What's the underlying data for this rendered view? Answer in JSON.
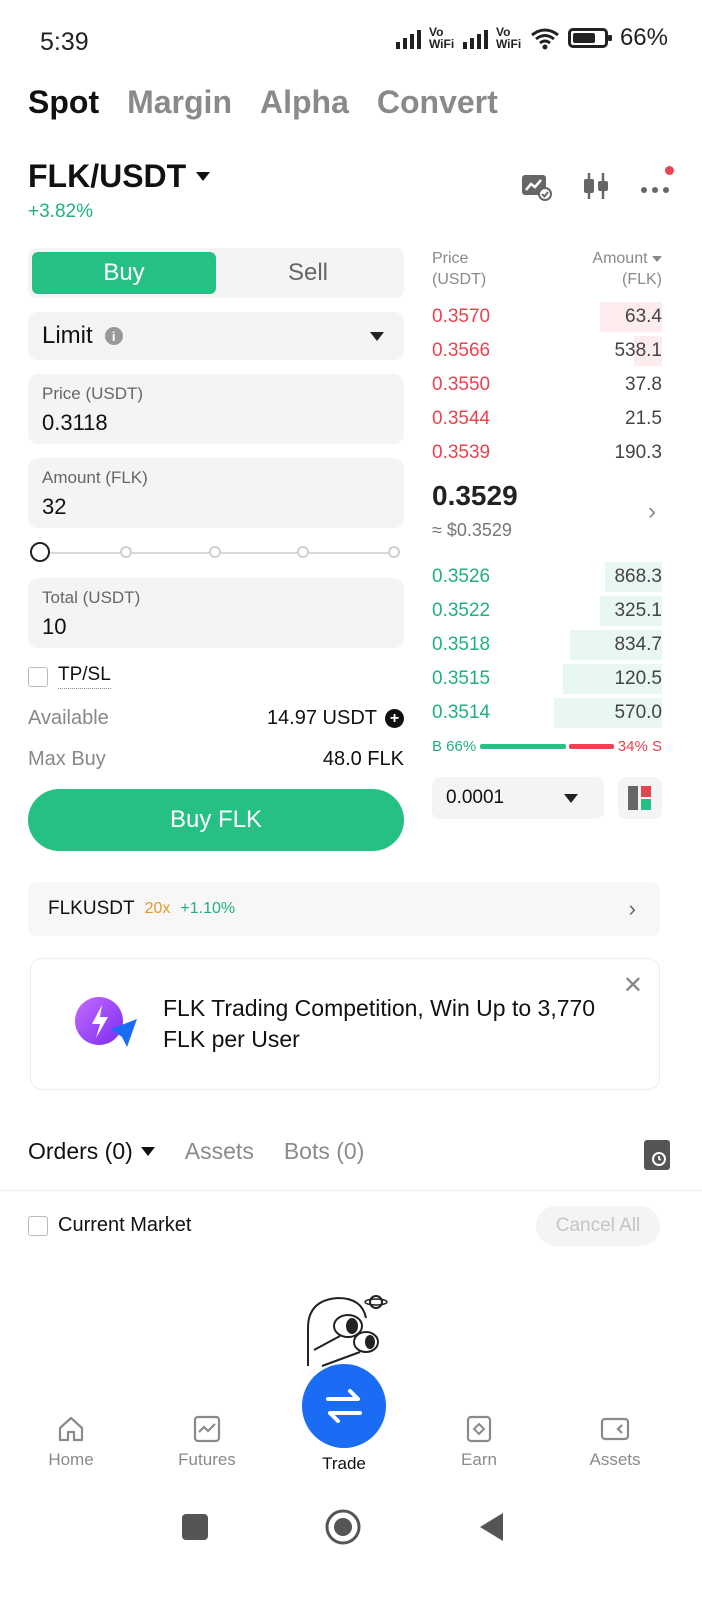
{
  "status_bar": {
    "time": "5:39",
    "net1": "Vo WiFi",
    "net2": "Vo WiFi",
    "battery": "66%"
  },
  "top_tabs": [
    {
      "label": "Spot",
      "active": true
    },
    {
      "label": "Margin",
      "active": false
    },
    {
      "label": "Alpha",
      "active": false
    },
    {
      "label": "Convert",
      "active": false
    }
  ],
  "pair": {
    "symbol": "FLK/USDT",
    "change": "+3.82%",
    "icons": [
      "chart-switch-icon",
      "candlestick-icon",
      "more-icon"
    ]
  },
  "order_form": {
    "buy_label": "Buy",
    "sell_label": "Sell",
    "order_type": "Limit",
    "price_label": "Price (USDT)",
    "price_value": "0.3118",
    "amount_label": "Amount (FLK)",
    "amount_value": "32",
    "total_label": "Total (USDT)",
    "total_value": "10",
    "tpsl_label": "TP/SL",
    "available_label": "Available",
    "available_value": "14.97 USDT",
    "max_buy_label": "Max Buy",
    "max_buy_value": "48.0 FLK",
    "submit_label": "Buy FLK",
    "slider_level": 0
  },
  "orderbook": {
    "price_header_1": "Price",
    "price_header_2": "(USDT)",
    "amount_header_1": "Amount",
    "amount_header_2": "(FLK)",
    "asks": [
      {
        "price": "0.3570",
        "amount": "63.4",
        "depth": 0.27
      },
      {
        "price": "0.3566",
        "amount": "538.1",
        "depth": 0.12
      },
      {
        "price": "0.3550",
        "amount": "37.8",
        "depth": 0.0
      },
      {
        "price": "0.3544",
        "amount": "21.5",
        "depth": 0.0
      },
      {
        "price": "0.3539",
        "amount": "190.3",
        "depth": 0.0
      }
    ],
    "mid_price": "0.3529",
    "mid_usd": "≈ $0.3529",
    "bids": [
      {
        "price": "0.3526",
        "amount": "868.3",
        "depth": 0.25
      },
      {
        "price": "0.3522",
        "amount": "325.1",
        "depth": 0.27
      },
      {
        "price": "0.3518",
        "amount": "834.7",
        "depth": 0.4
      },
      {
        "price": "0.3515",
        "amount": "120.5",
        "depth": 0.43
      },
      {
        "price": "0.3514",
        "amount": "570.0",
        "depth": 0.47
      }
    ],
    "buy_ratio_label": "B 66%",
    "sell_ratio_label": "34% S",
    "buy_ratio": 66,
    "sell_ratio": 34,
    "precision": "0.0001"
  },
  "futures_banner": {
    "symbol": "FLKUSDT",
    "leverage": "20x",
    "change": "+1.10%"
  },
  "promo": {
    "text": "FLK Trading Competition, Win Up to 3,770 FLK per User"
  },
  "orders": {
    "tabs": [
      "Orders (0)",
      "Assets",
      "Bots (0)"
    ],
    "current_market_label": "Current Market",
    "cancel_all_label": "Cancel All"
  },
  "bottom_nav": [
    {
      "label": "Home",
      "icon": "home-icon"
    },
    {
      "label": "Futures",
      "icon": "futures-icon"
    },
    {
      "label": "Trade",
      "icon": "trade-swap-icon"
    },
    {
      "label": "Earn",
      "icon": "earn-icon"
    },
    {
      "label": "Assets",
      "icon": "wallet-icon"
    }
  ],
  "colors": {
    "green": "#27c084",
    "red": "#e8434f",
    "trade_blue": "#1a6cf5"
  }
}
